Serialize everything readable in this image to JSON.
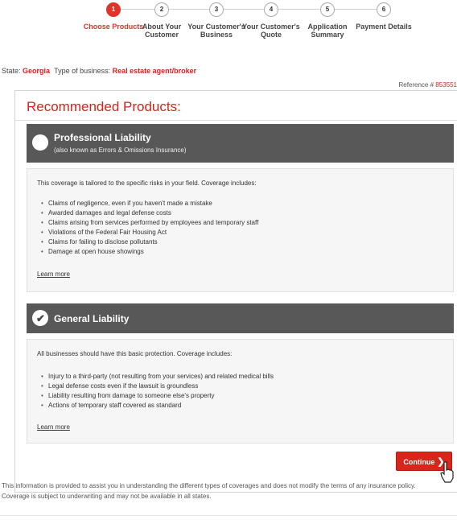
{
  "stepper": {
    "steps": [
      {
        "num": "1",
        "label": "Choose Products"
      },
      {
        "num": "2",
        "label": "About Your Customer"
      },
      {
        "num": "3",
        "label": "Your Customer's Business"
      },
      {
        "num": "4",
        "label": "Your Customer's Quote"
      },
      {
        "num": "5",
        "label": "Application Summary"
      },
      {
        "num": "6",
        "label": "Payment Details"
      }
    ]
  },
  "context": {
    "state_label": "State:",
    "state_value": "Georgia",
    "business_label": "Type of business:",
    "business_value": "Real estate agent/broker",
    "reference_label": "Reference #",
    "reference_value": "853551"
  },
  "panel": {
    "title": "Recommended Products:"
  },
  "products": [
    {
      "name": "Professional Liability",
      "subtitle": "(also known as Errors & Omissions Insurance)",
      "intro": "This coverage is tailored to the specific risks in your field. Coverage includes:",
      "bullets": [
        "Claims of negligence, even if you haven't made a mistake",
        "Awarded damages and legal defense costs",
        "Claims arising from services performed by employees and temporary staff",
        "Violations of the Federal Fair Housing Act",
        "Claims for failing to disclose pollutants",
        "Damage at open house showings"
      ],
      "learn_more": "Learn more"
    },
    {
      "name": "General Liability",
      "intro": "All businesses should have this basic protection. Coverage includes:",
      "bullets": [
        "Injury to a third-party (not resulting from your services) and related medical bills",
        "Legal defense costs even if the lawsuit is groundless",
        "Liability resulting from damage to someone else's property",
        "Actions of temporary staff covered as standard"
      ],
      "learn_more": "Learn more"
    }
  ],
  "actions": {
    "continue_label": "Continue"
  },
  "footer": {
    "disclaimer": "This information is provided to assist you in understanding the different types of coverages and does not modify the terms of any insurance policy. Coverage is subject to underwriting and may not be available in all states."
  },
  "colors": {
    "accent": "#d0261d",
    "bar": "#585858"
  }
}
